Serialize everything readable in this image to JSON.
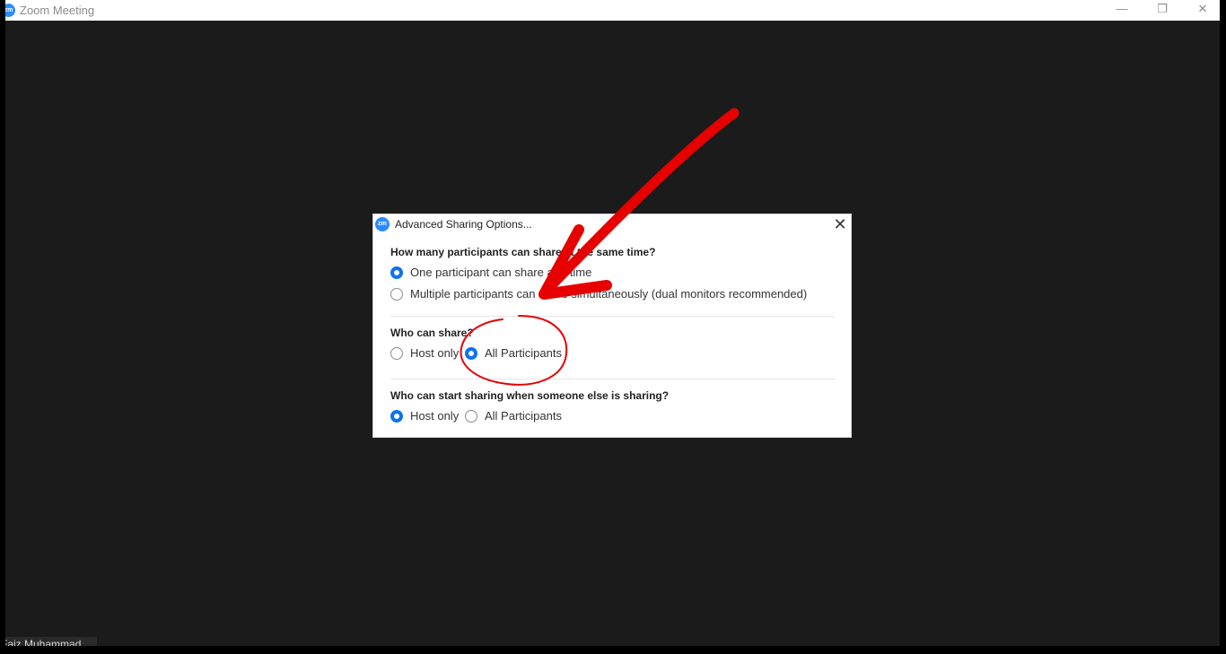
{
  "window": {
    "title": "Zoom Meeting",
    "controls": {
      "minimize": "—",
      "maximize": "❐",
      "close": "✕"
    },
    "participant_name": "Faiz Muhammad"
  },
  "dialog": {
    "logo": "zm",
    "title": "Advanced Sharing Options...",
    "close": "✕",
    "q1": {
      "label": "How many participants can share at the same time?",
      "options": [
        {
          "label": "One participant can share at a time",
          "checked": true
        },
        {
          "label": "Multiple participants can share simultaneously (dual monitors recommended)",
          "checked": false
        }
      ]
    },
    "q2": {
      "label": "Who can share?",
      "options": [
        {
          "label": "Host only",
          "checked": false
        },
        {
          "label": "All Participants",
          "checked": true
        }
      ]
    },
    "q3": {
      "label": "Who can start sharing when someone else is sharing?",
      "options": [
        {
          "label": "Host only",
          "checked": true
        },
        {
          "label": "All Participants",
          "checked": false
        }
      ]
    }
  },
  "colors": {
    "accent": "#0e72ed",
    "annotation": "#e60000",
    "background": "#1b1b1b"
  }
}
